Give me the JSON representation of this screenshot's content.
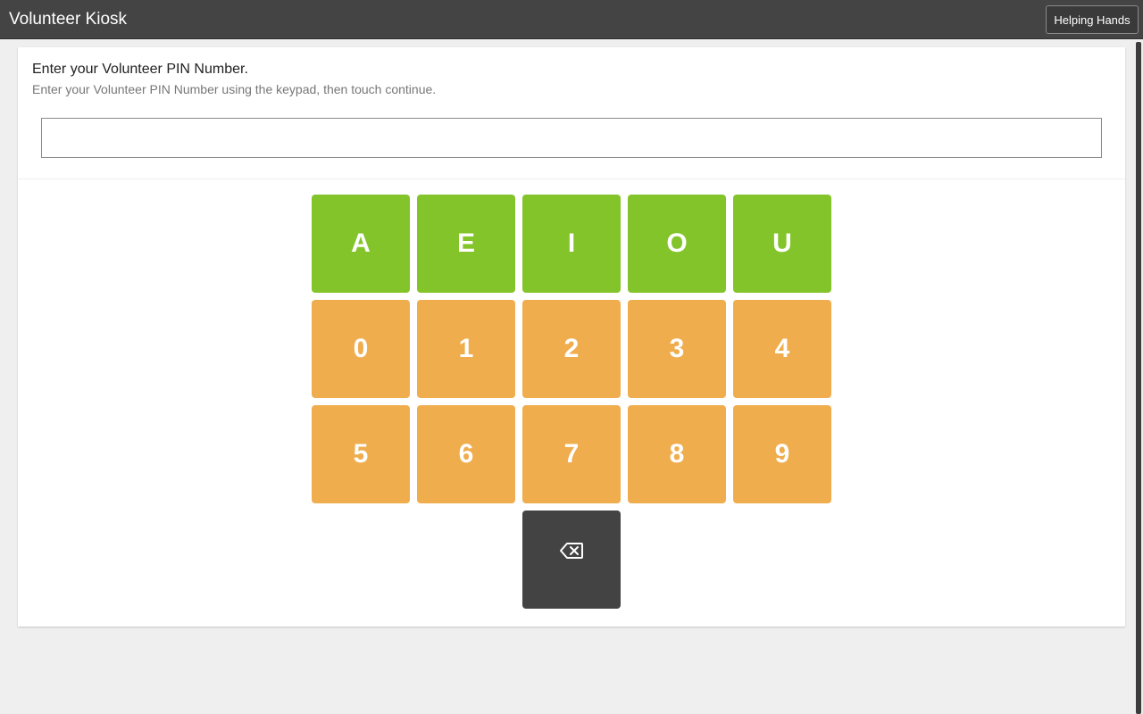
{
  "header": {
    "app_title": "Volunteer Kiosk",
    "org_button_label": "Helping Hands"
  },
  "prompt": {
    "title": "Enter your Volunteer PIN Number.",
    "subtitle": "Enter your Volunteer PIN Number using the keypad, then touch continue."
  },
  "pin_input": {
    "value": "",
    "placeholder": ""
  },
  "keypad": {
    "vowels": [
      "A",
      "E",
      "I",
      "O",
      "U"
    ],
    "digits_row1": [
      "0",
      "1",
      "2",
      "3",
      "4"
    ],
    "digits_row2": [
      "5",
      "6",
      "7",
      "8",
      "9"
    ],
    "backspace_icon": "backspace-icon"
  },
  "colors": {
    "vowel_key": "#83c42a",
    "digit_key": "#efad4e",
    "backspace_key": "#434343",
    "topbar": "#444444"
  }
}
